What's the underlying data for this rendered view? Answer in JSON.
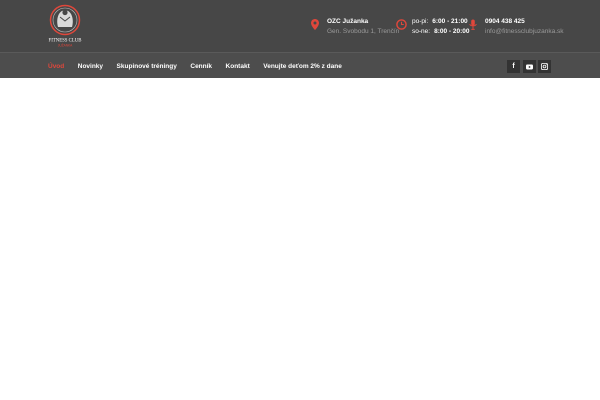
{
  "header": {
    "logo": {
      "text": "FITNESS CLUB",
      "subtext": "JUŽANKA"
    },
    "address": {
      "icon": "map-marker-icon",
      "title": "OZC Južanka",
      "line": "Gen. Svobodu 1, Trenčín"
    },
    "hours": {
      "icon": "clock-icon",
      "rows": [
        {
          "days": "po-pi:",
          "time": "6:00 - 21:00"
        },
        {
          "days": "so-ne:",
          "time": "8:00 - 20:00"
        }
      ]
    },
    "contact": {
      "icon": "microphone-icon",
      "phone": "0904 438 425",
      "email": "info@fitnessclubjuzanka.sk"
    }
  },
  "nav": {
    "items": [
      {
        "label": "Úvod",
        "active": true
      },
      {
        "label": "Novinky"
      },
      {
        "label": "Skupinové tréningy"
      },
      {
        "label": "Cenník"
      },
      {
        "label": "Kontakt"
      },
      {
        "label": "Venujte deťom 2% z dane"
      }
    ]
  },
  "social": [
    {
      "name": "facebook-icon",
      "glyph": "f"
    },
    {
      "name": "youtube-icon"
    },
    {
      "name": "instagram-icon"
    }
  ],
  "colors": {
    "accent": "#e0473b",
    "topbar": "#474747",
    "navbar": "#4d4d4d",
    "social_bg": "#333333"
  }
}
